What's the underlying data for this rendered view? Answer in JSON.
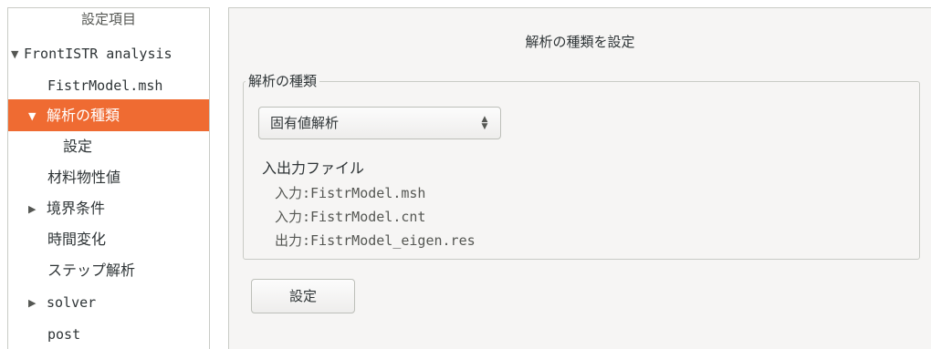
{
  "tree": {
    "header": "設定項目",
    "items": [
      {
        "label": "FrontISTR analysis",
        "arrow": "▼"
      },
      {
        "label": "FistrModel.msh",
        "arrow": ""
      },
      {
        "label": "解析の種類",
        "arrow": "▼"
      },
      {
        "label": "設定",
        "arrow": ""
      },
      {
        "label": "材料物性値",
        "arrow": ""
      },
      {
        "label": "境界条件",
        "arrow": "▶"
      },
      {
        "label": "時間変化",
        "arrow": ""
      },
      {
        "label": "ステップ解析",
        "arrow": ""
      },
      {
        "label": "solver",
        "arrow": "▶"
      },
      {
        "label": "post",
        "arrow": ""
      }
    ]
  },
  "main": {
    "title": "解析の種類を設定",
    "group_label": "解析の種類",
    "analysis_type": "固有値解析",
    "combo_arrows": "▲▼",
    "io_title": "入出力ファイル",
    "io_files": [
      "入力:FistrModel.msh",
      "入力:FistrModel.cnt",
      "出力:FistrModel_eigen.res"
    ],
    "set_button": "設定"
  },
  "colors": {
    "selected_row": "#ef6b32",
    "panel_bg": "#f6f5f4"
  }
}
